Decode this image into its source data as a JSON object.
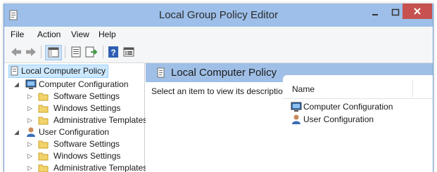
{
  "window": {
    "title": "Local Group Policy Editor"
  },
  "menu": [
    "File",
    "Action",
    "View",
    "Help"
  ],
  "tree": {
    "root": "Local Computer Policy",
    "computer": "Computer Configuration",
    "user": "User Configuration",
    "children": [
      "Software Settings",
      "Windows Settings",
      "Administrative Templates"
    ]
  },
  "right": {
    "title": "Local Computer Policy",
    "description": "Select an item to view its description.",
    "column_name": "Name",
    "items": [
      "Computer Configuration",
      "User Configuration"
    ]
  },
  "colors": {
    "titlebar": "#9dbfe9",
    "close": "#c75050",
    "header": "#9fbfe6",
    "folder": "#f2d36b"
  }
}
